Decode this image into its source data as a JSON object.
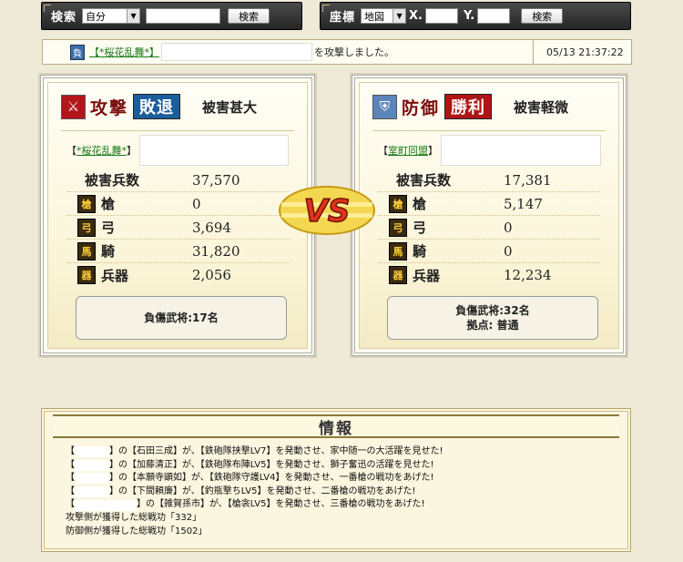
{
  "search_bar": {
    "label": "検索",
    "select_value": "自分",
    "input_value": "",
    "button": "検索"
  },
  "coord_bar": {
    "label": "座標",
    "select_value": "地図",
    "x_label": "X.",
    "x_value": "",
    "y_label": "Y.",
    "y_value": "",
    "button": "検索"
  },
  "message": {
    "result_badge": "負",
    "alliance_link": "【*桜花乱舞*】",
    "text": "を攻撃しました。",
    "timestamp": "05/13 21:37:22"
  },
  "attacker": {
    "type_label": "攻撃",
    "result": "敗退",
    "result_color": "#1c5e9c",
    "damage_text": "被害甚大",
    "alliance_prefix": "【",
    "alliance": "*桜花乱舞*",
    "alliance_suffix": "】",
    "total_label": "被害兵数",
    "total": "37,570",
    "units": [
      {
        "icon": "spear-icon",
        "label": "槍",
        "value": "0"
      },
      {
        "icon": "bow-icon",
        "label": "弓",
        "value": "3,694"
      },
      {
        "icon": "horse-icon",
        "label": "騎",
        "value": "31,820"
      },
      {
        "icon": "siege-weapon-icon",
        "label": "兵器",
        "value": "2,056"
      }
    ],
    "injured": "負傷武将:17名",
    "base": ""
  },
  "defender": {
    "type_label": "防御",
    "result": "勝利",
    "result_color": "#b01515",
    "damage_text": "被害軽微",
    "alliance_prefix": "【",
    "alliance": "室町同盟",
    "alliance_suffix": "】",
    "total_label": "被害兵数",
    "total": "17,381",
    "units": [
      {
        "icon": "spear-icon",
        "label": "槍",
        "value": "5,147"
      },
      {
        "icon": "bow-icon",
        "label": "弓",
        "value": "0"
      },
      {
        "icon": "horse-icon",
        "label": "騎",
        "value": "0"
      },
      {
        "icon": "siege-weapon-icon",
        "label": "兵器",
        "value": "12,234"
      }
    ],
    "injured": "負傷武将:32名",
    "base": "拠点: 普通"
  },
  "vs_text": "VS",
  "info": {
    "title": "情報",
    "lines": [
      {
        "pre": "【",
        "post": "】の【石田三成】が、【鉄砲隊挟撃LV7】を発動させ、家中随一の大活躍を見せた!"
      },
      {
        "pre": "【",
        "post": "】の【加藤清正】が、【鉄砲隊布陣LV5】を発動させ、獅子奮迅の活躍を見せた!"
      },
      {
        "pre": "【",
        "post": "】の【本願寺顕如】が、【鉄砲隊守護LV4】を発動させ、一番槍の戦功をあげた!"
      },
      {
        "pre": "【",
        "post": "】の【下間頼廉】が、【釣瓶撃ちLV5】を発動させ、二番槍の戦功をあげた!"
      },
      {
        "pre": "【",
        "post": "】の【雑賀孫市】が、【槍衾LV5】を発動させ、三番槍の戦功をあげた!"
      }
    ],
    "summary": [
      "攻撃側が獲得した総戦功「332」",
      "防御側が獲得した総戦功「1502」"
    ]
  }
}
